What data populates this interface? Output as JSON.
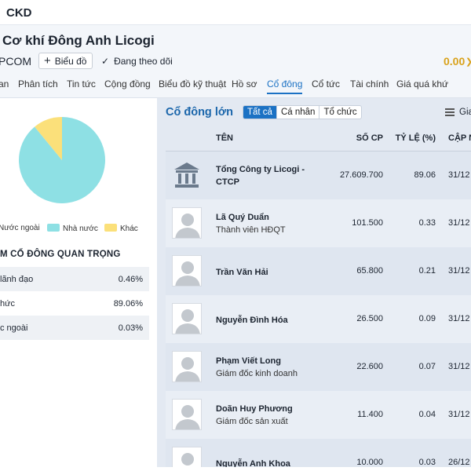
{
  "header": {
    "ticker": "CKD"
  },
  "company": {
    "name": "Cơ khí Đông Anh Licogi",
    "exchange": "PCOM",
    "chart_button": "Biểu đồ",
    "follow_label": "Đang theo dõi",
    "price": "0.00"
  },
  "tabs": [
    "an",
    "Phân tích",
    "Tin tức",
    "Cộng đồng",
    "Biểu đồ kỹ thuật",
    "Hồ sơ",
    "Cổ đông",
    "Cổ tức",
    "Tài chính",
    "Giá quá khứ"
  ],
  "pie": {
    "colors": {
      "Nhà nước": "#8ee0e4",
      "Khác": "#fbe07a"
    },
    "legend": [
      "Nước ngoài",
      "Nhà nước",
      "Khác"
    ],
    "share_nha_nuoc_pct": 89.06
  },
  "key_shareholders": {
    "title": "M CỔ ĐÔNG QUAN TRỌNG",
    "rows": [
      {
        "label": "lãnh đạo",
        "value": "0.46%"
      },
      {
        "label": "c ngoài",
        "value": "0.03%"
      },
      {
        "label": "hức",
        "value": "89.06%"
      }
    ]
  },
  "major": {
    "title": "Cổ đông lớn",
    "filters": [
      "Tất cả",
      "Cá nhân",
      "Tổ chức"
    ],
    "active_filter": "Tất cả",
    "view_label": "Giao",
    "columns": [
      "TÊN",
      "SỐ CP",
      "TỶ LỆ (%)",
      "CẬP N"
    ],
    "rows": [
      {
        "name": "Tổng Công ty Licogi -",
        "name2": "CTCP",
        "position": "",
        "shares": "27.609.700",
        "ratio": "89.06",
        "date": "31/12",
        "type": "org"
      },
      {
        "name": "Lã Quý Duẩn",
        "name2": "",
        "position": "Thành viên HĐQT",
        "shares": "101.500",
        "ratio": "0.33",
        "date": "31/12",
        "type": "person"
      },
      {
        "name": "Trần Văn Hải",
        "name2": "",
        "position": "",
        "shares": "65.800",
        "ratio": "0.21",
        "date": "31/12",
        "type": "person"
      },
      {
        "name": "Nguyễn Đình Hóa",
        "name2": "",
        "position": "",
        "shares": "26.500",
        "ratio": "0.09",
        "date": "31/12",
        "type": "person"
      },
      {
        "name": "Phạm Viết Long",
        "name2": "",
        "position": "Giám đốc kinh doanh",
        "shares": "22.600",
        "ratio": "0.07",
        "date": "31/12",
        "type": "person"
      },
      {
        "name": "Doãn Huy Phương",
        "name2": "",
        "position": "Giám đốc sản xuất",
        "shares": "11.400",
        "ratio": "0.04",
        "date": "31/12",
        "type": "person"
      },
      {
        "name": "Nguyễn Anh Khoa",
        "name2": "",
        "position": "",
        "shares": "10.000",
        "ratio": "0.03",
        "date": "26/12",
        "type": "person"
      }
    ]
  }
}
